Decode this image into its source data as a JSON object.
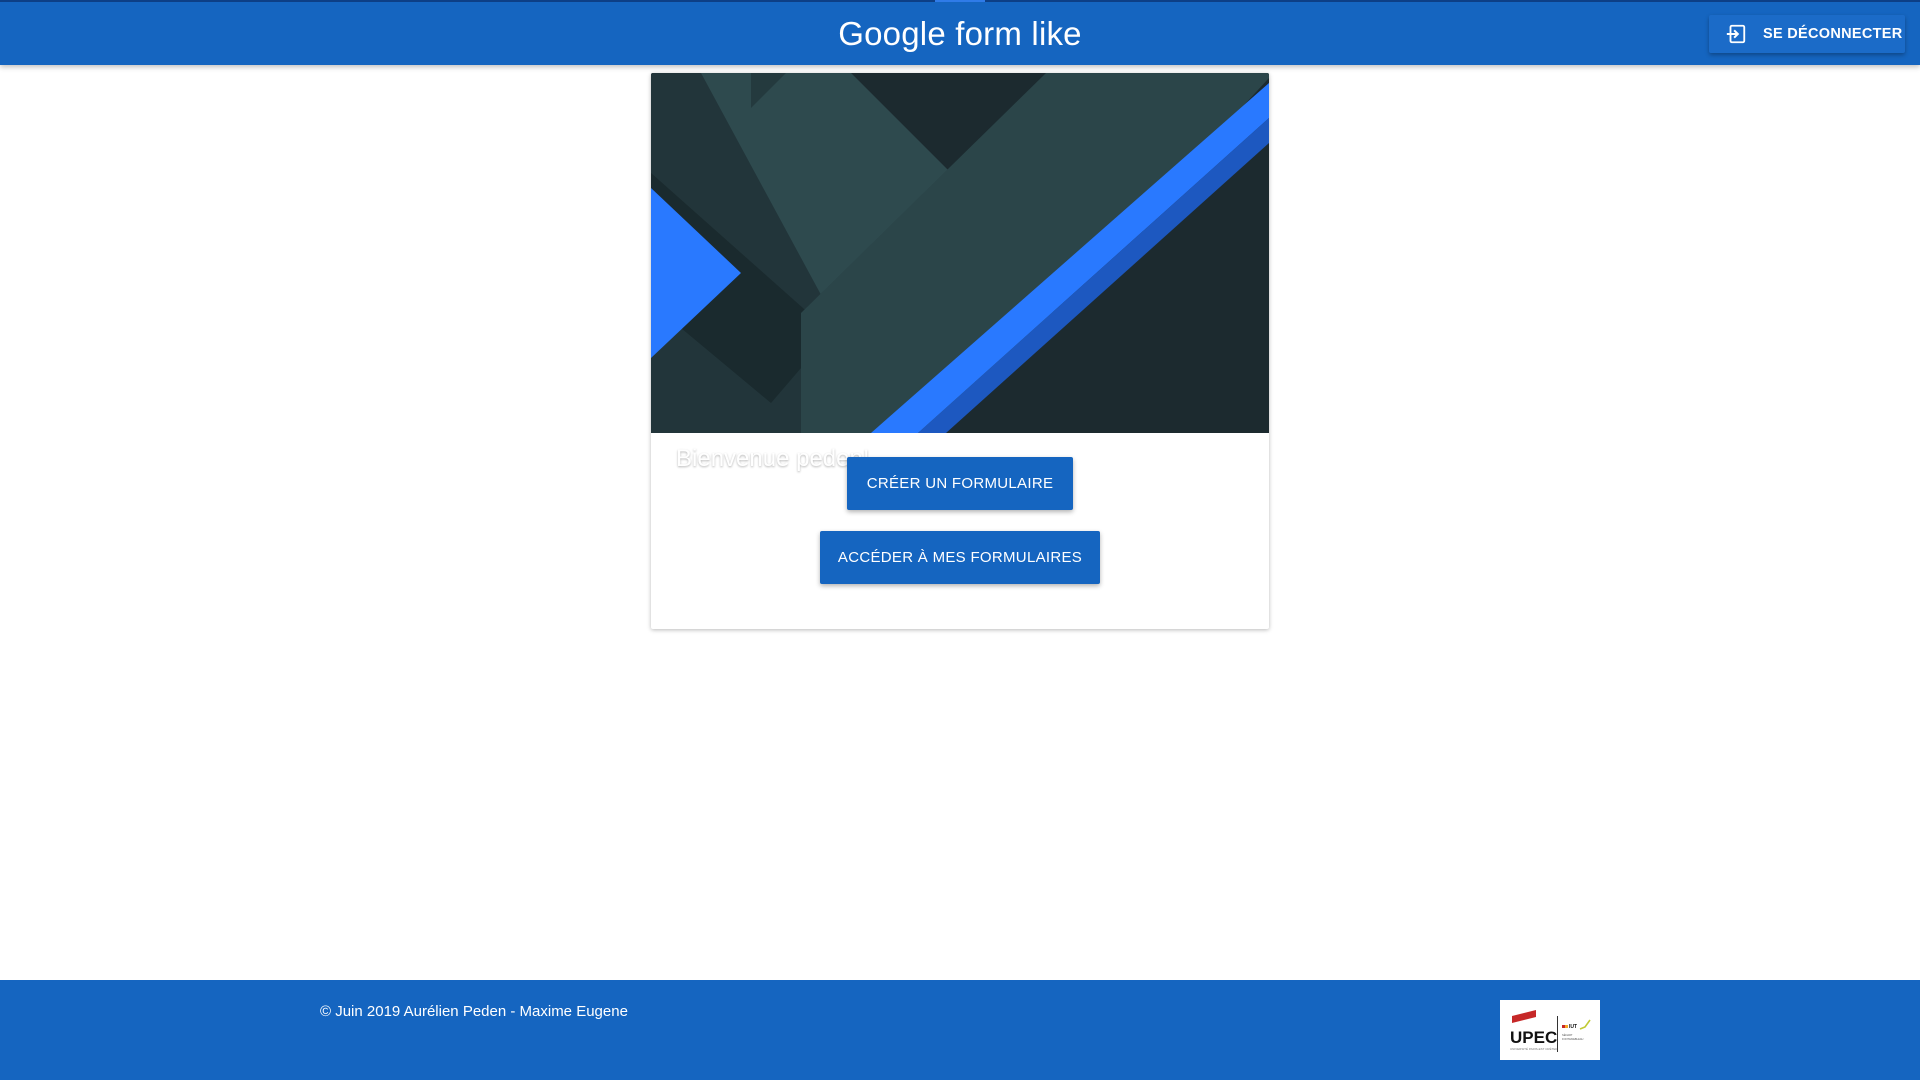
{
  "header": {
    "title": "Google form like",
    "logout_label": "SE DÉCONNECTER",
    "logout_icon": "logout-icon"
  },
  "card": {
    "welcome_text": "Bienvenue peden!",
    "create_form_label": "CRÉER UN FORMULAIRE",
    "my_forms_label": "ACCÉDER À MES FORMULAIRES"
  },
  "footer": {
    "copyright": "© Juin 2019 Aurélien Peden - Maxime Eugene",
    "logo": {
      "main_text": "UPEC",
      "side_text": "IUT",
      "icon": "upec-logo"
    }
  },
  "colors": {
    "primary": "#1565c0",
    "banner_dark": "#1c2a2f",
    "banner_teal": "#2c4549",
    "banner_blue": "#2979ff"
  }
}
